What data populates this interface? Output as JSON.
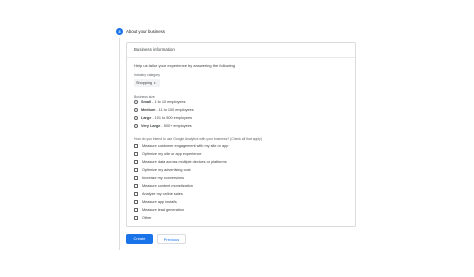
{
  "step": {
    "number": "3",
    "title": "About your business"
  },
  "card": {
    "title": "Business information",
    "intro": "Help us tailor your experience by answering the following",
    "industry": {
      "label": "Industry category",
      "value": "Shopping"
    },
    "size": {
      "label": "Business size",
      "options": [
        {
          "name": "Small",
          "desc": "- 1 to 10 employees"
        },
        {
          "name": "Medium",
          "desc": "- 11 to 100 employees"
        },
        {
          "name": "Large",
          "desc": "- 101 to 500 employees"
        },
        {
          "name": "Very Large",
          "desc": "- 500+ employees"
        }
      ]
    },
    "usage": {
      "label": "How do you intend to use Google Analytics with your business? (Check all that apply)",
      "options": [
        "Measure customer engagement with my site or app",
        "Optimize my site or app experience",
        "Measure data across multiple devices or platforms",
        "Optimize my advertising cost",
        "Increase my conversions",
        "Measure content monetization",
        "Analyze my online sales",
        "Measure app installs",
        "Measure lead generation",
        "Other"
      ]
    }
  },
  "buttons": {
    "create": "Create",
    "previous": "Previous"
  },
  "colors": {
    "accent": "#1a73e8",
    "border": "#dadce0"
  }
}
